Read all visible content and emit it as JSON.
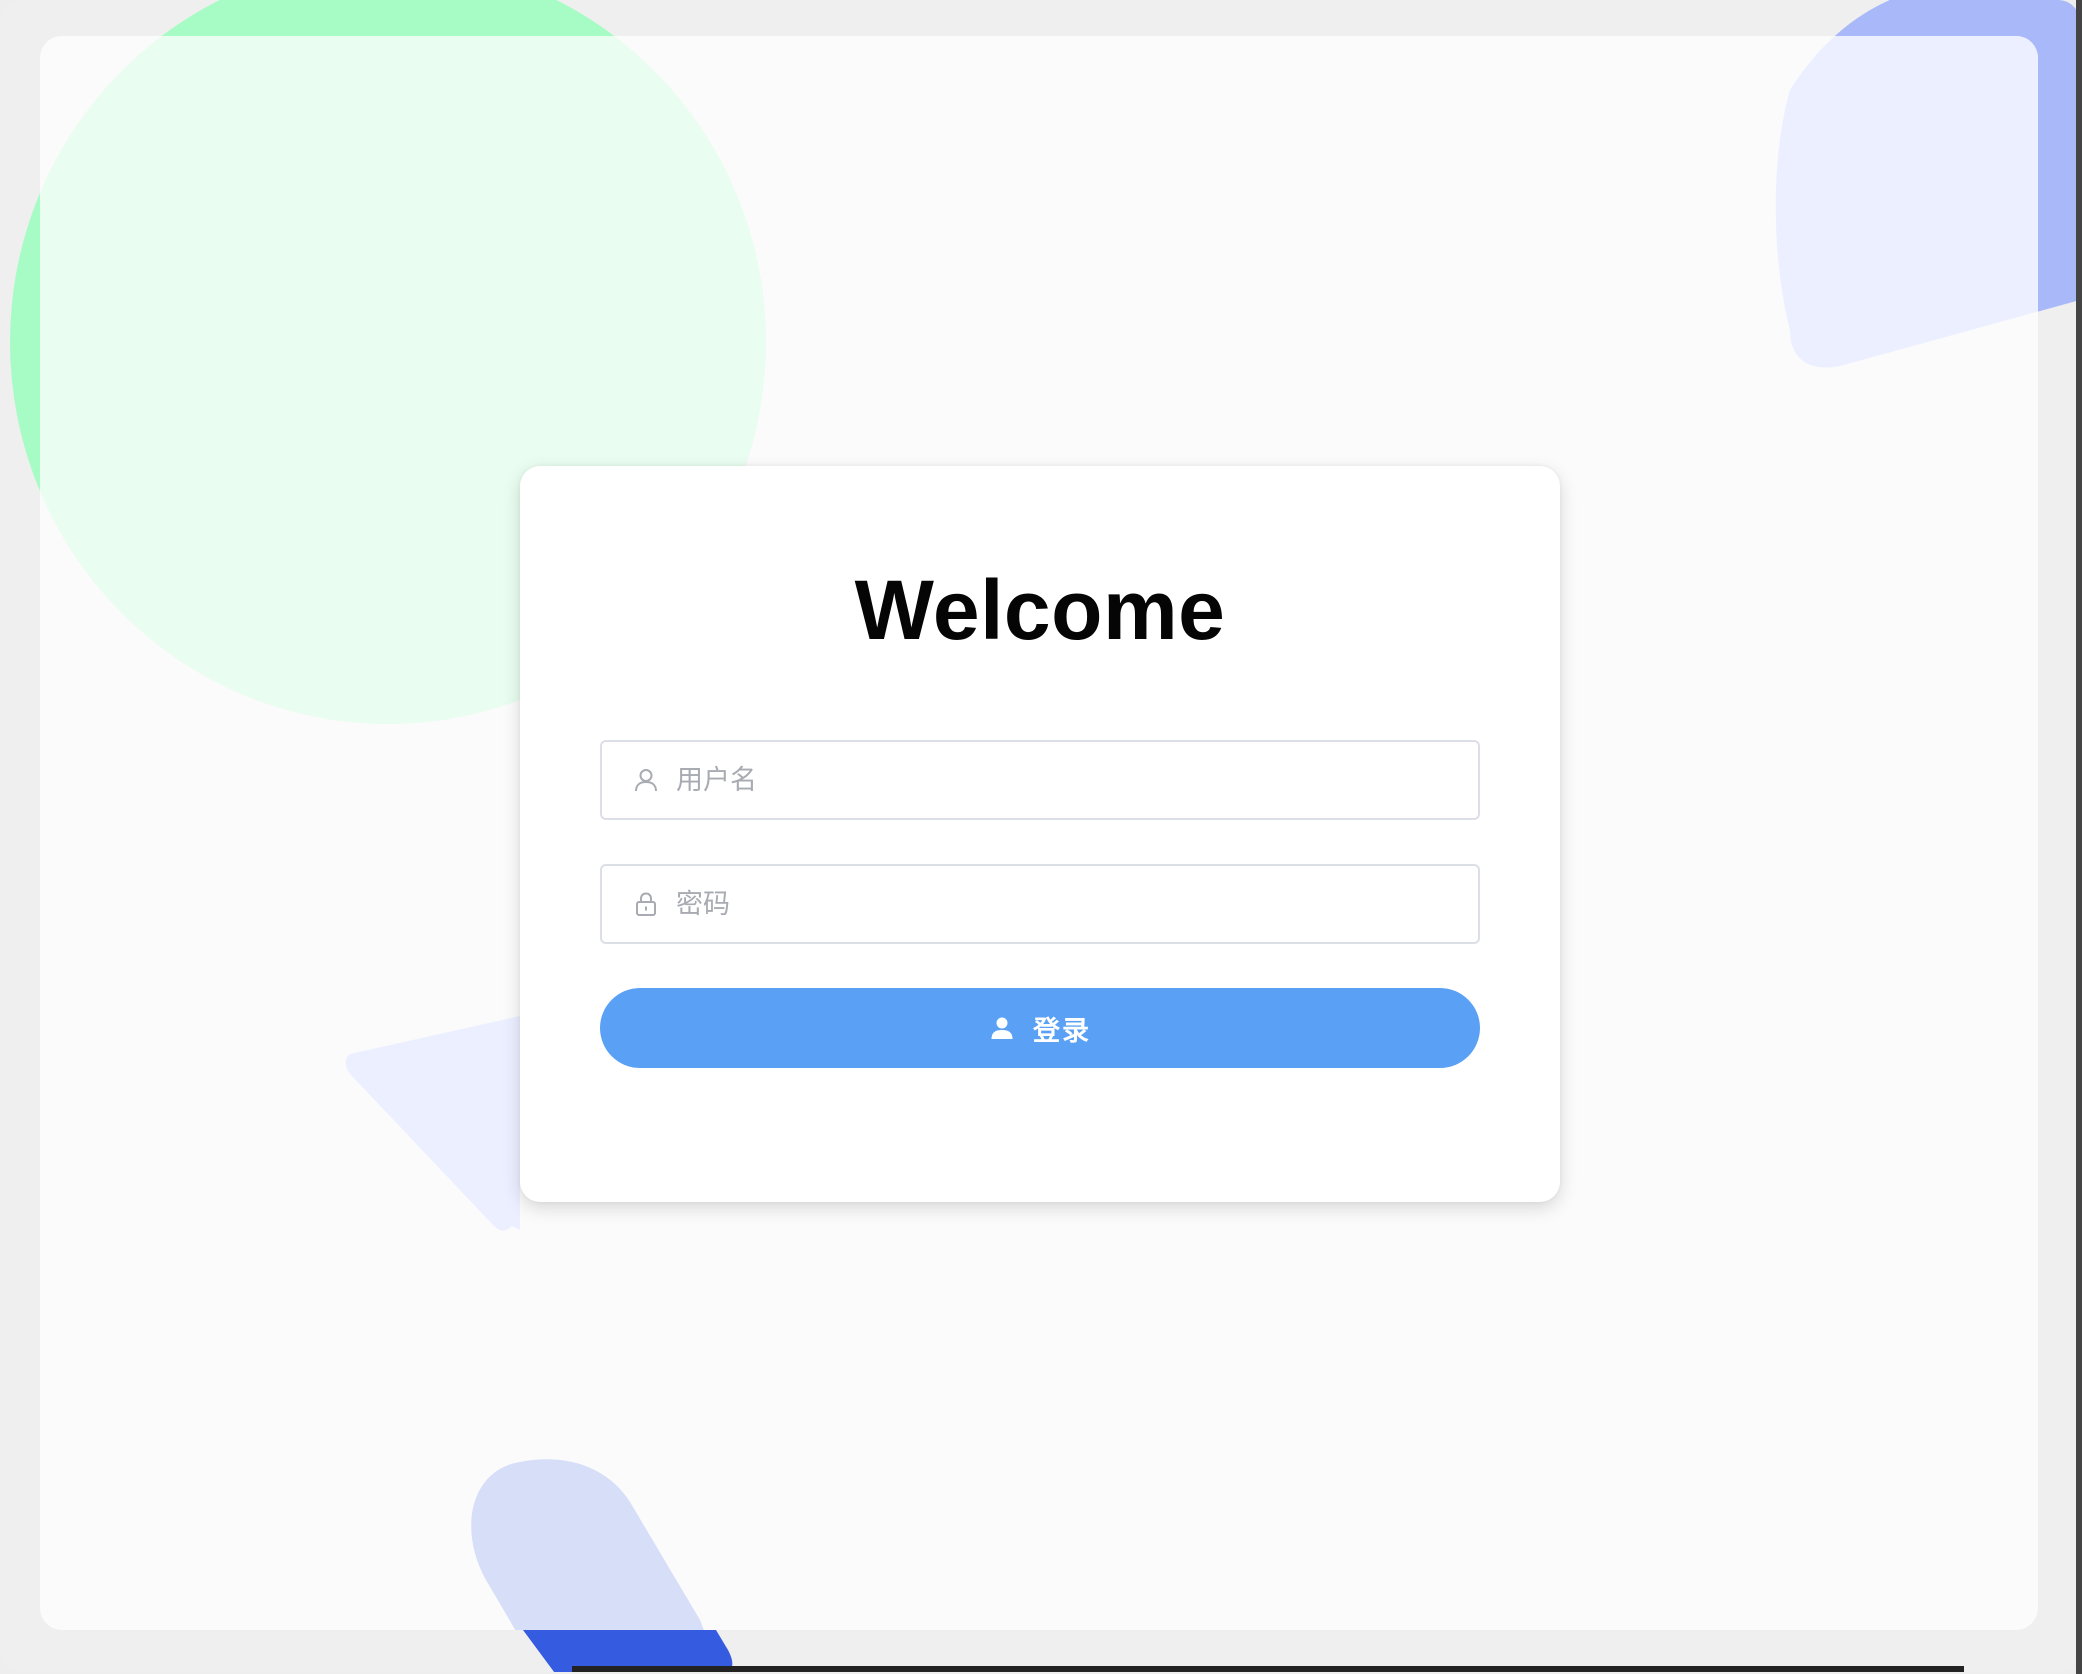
{
  "login": {
    "title": "Welcome",
    "username": {
      "placeholder": "用户名",
      "value": "",
      "icon": "user-icon"
    },
    "password": {
      "placeholder": "密码",
      "value": "",
      "icon": "lock-icon"
    },
    "submit": {
      "label": "登录",
      "icon": "user-filled-icon"
    }
  },
  "colors": {
    "primary_button": "#5aa0f5",
    "title_text": "#050505",
    "placeholder_text": "#a8abb2",
    "field_border": "#dcdfe6",
    "deco_green": "#a6fcc4",
    "deco_blue": "#a8b8f8",
    "deco_blue_dark": "#355be0"
  }
}
